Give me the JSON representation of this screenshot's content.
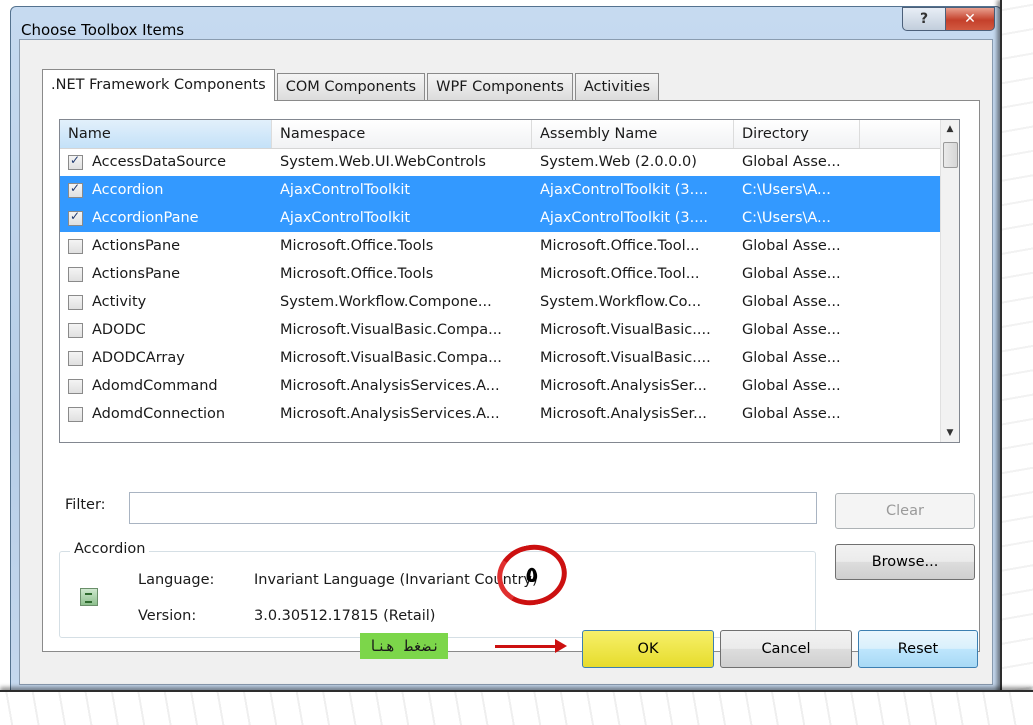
{
  "window": {
    "title": "Choose Toolbox Items",
    "help_glyph": "?",
    "close_glyph": "✕"
  },
  "tabs": [
    ".NET Framework Components",
    "COM Components",
    "WPF Components",
    "Activities"
  ],
  "grid": {
    "columns": [
      "Name",
      "Namespace",
      "Assembly Name",
      "Directory"
    ],
    "rows": [
      {
        "checked": true,
        "selected": false,
        "name": "AccessDataSource",
        "namespace": "System.Web.UI.WebControls",
        "assembly": "System.Web (2.0.0.0)",
        "directory": "Global Asse..."
      },
      {
        "checked": true,
        "selected": true,
        "name": "Accordion",
        "namespace": "AjaxControlToolkit",
        "assembly": "AjaxControlToolkit (3....",
        "directory": "C:\\Users\\A..."
      },
      {
        "checked": true,
        "selected": true,
        "name": "AccordionPane",
        "namespace": "AjaxControlToolkit",
        "assembly": "AjaxControlToolkit (3....",
        "directory": "C:\\Users\\A..."
      },
      {
        "checked": false,
        "selected": false,
        "name": "ActionsPane",
        "namespace": "Microsoft.Office.Tools",
        "assembly": "Microsoft.Office.Tool...",
        "directory": "Global Asse..."
      },
      {
        "checked": false,
        "selected": false,
        "name": "ActionsPane",
        "namespace": "Microsoft.Office.Tools",
        "assembly": "Microsoft.Office.Tool...",
        "directory": "Global Asse..."
      },
      {
        "checked": false,
        "selected": false,
        "name": "Activity",
        "namespace": "System.Workflow.Compone...",
        "assembly": "System.Workflow.Co...",
        "directory": "Global Asse..."
      },
      {
        "checked": false,
        "selected": false,
        "name": "ADODC",
        "namespace": "Microsoft.VisualBasic.Compa...",
        "assembly": "Microsoft.VisualBasic....",
        "directory": "Global Asse..."
      },
      {
        "checked": false,
        "selected": false,
        "name": "ADODCArray",
        "namespace": "Microsoft.VisualBasic.Compa...",
        "assembly": "Microsoft.VisualBasic....",
        "directory": "Global Asse..."
      },
      {
        "checked": false,
        "selected": false,
        "name": "AdomdCommand",
        "namespace": "Microsoft.AnalysisServices.A...",
        "assembly": "Microsoft.AnalysisSer...",
        "directory": "Global Asse..."
      },
      {
        "checked": false,
        "selected": false,
        "name": "AdomdConnection",
        "namespace": "Microsoft.AnalysisServices.A...",
        "assembly": "Microsoft.AnalysisSer...",
        "directory": "Global Asse..."
      }
    ]
  },
  "filter": {
    "label": "Filter:",
    "value": "",
    "clear_label": "Clear"
  },
  "details": {
    "title": "Accordion",
    "language_label": "Language:",
    "language_value": "Invariant Language (Invariant Country)",
    "version_label": "Version:",
    "version_value": "3.0.30512.17815 (Retail)"
  },
  "buttons": {
    "browse": "Browse...",
    "ok": "OK",
    "cancel": "Cancel",
    "reset": "Reset"
  },
  "annotation": {
    "step_digit": "٥",
    "hint_text": "نضغط هنا"
  },
  "colors": {
    "selection": "#3399ff",
    "ok_highlight": "#f0e640",
    "annotation_red": "#cc1010",
    "hint_green": "#7cd64a"
  }
}
